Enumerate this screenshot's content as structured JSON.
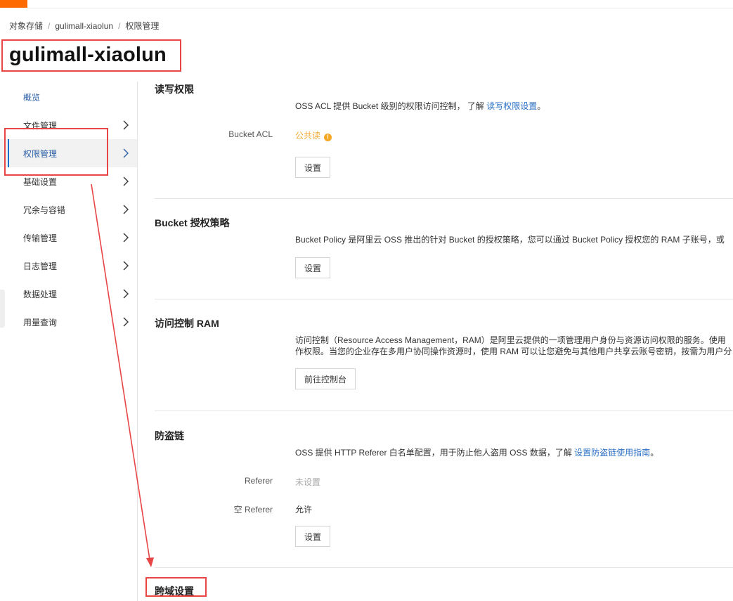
{
  "breadcrumb": {
    "items": [
      "对象存储",
      "gulimall-xiaolun",
      "权限管理"
    ],
    "separator": "/"
  },
  "page_title": "gulimall-xiaolun",
  "sidebar": {
    "items": [
      {
        "label": "概览"
      },
      {
        "label": "文件管理"
      },
      {
        "label": "权限管理"
      },
      {
        "label": "基础设置"
      },
      {
        "label": "冗余与容错"
      },
      {
        "label": "传输管理"
      },
      {
        "label": "日志管理"
      },
      {
        "label": "数据处理"
      },
      {
        "label": "用量查询"
      }
    ],
    "active": "权限管理"
  },
  "sections": {
    "read_write": {
      "title": "读写权限",
      "desc_prefix": "OSS ACL 提供 Bucket 级别的权限访问控制， 了解",
      "desc_link": "读写权限设置",
      "desc_suffix": "。",
      "acl_label": "Bucket ACL",
      "acl_value": "公共读",
      "acl_icon": "warning-icon",
      "button": "设置"
    },
    "policy": {
      "title": "Bucket 授权策略",
      "desc": "Bucket Policy 是阿里云 OSS 推出的针对 Bucket 的授权策略，您可以通过 Bucket Policy 授权您的 RAM 子账号，或",
      "button": "设置"
    },
    "ram": {
      "title": "访问控制 RAM",
      "desc_line1": "访问控制（Resource Access Management，RAM）是阿里云提供的一项管理用户身份与资源访问权限的服务。使用",
      "desc_line2": "作权限。当您的企业存在多用户协同操作资源时，使用 RAM 可以让您避免与其他用户共享云账号密钥，按需为用户分",
      "button": "前往控制台"
    },
    "hotlink": {
      "title": "防盗链",
      "desc_prefix": "OSS 提供 HTTP Referer 白名单配置，用于防止他人盗用 OSS 数据，了解",
      "desc_link": "设置防盗链使用指南",
      "desc_suffix": "。",
      "referer_label": "Referer",
      "referer_value": "未设置",
      "empty_referer_label": "空 Referer",
      "empty_referer_value": "允许",
      "button": "设置"
    },
    "cors": {
      "title": "跨域设置"
    }
  },
  "colors": {
    "accent": "#ff6a00",
    "link": "#2a6fc3",
    "active_nav_text": "#2a5ea5",
    "warning": "#f5a623",
    "annotation": "#e84545",
    "muted": "#aaaaaa"
  }
}
